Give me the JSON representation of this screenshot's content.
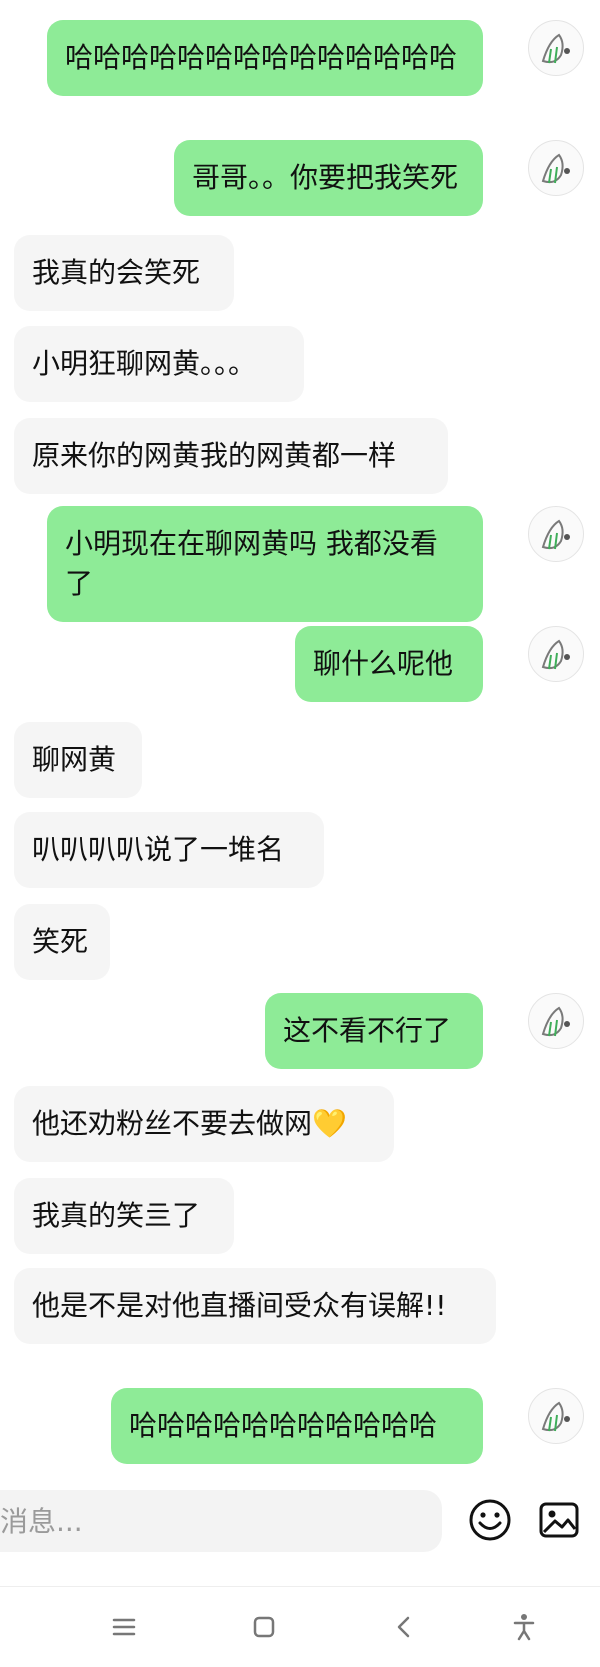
{
  "messages": [
    {
      "sender": "me",
      "text": "哈哈哈哈哈哈哈哈哈哈哈哈哈哈"
    },
    {
      "sender": "me",
      "text": "哥哥。。你要把我笑死"
    },
    {
      "sender": "them",
      "text": "我真的会笑死"
    },
    {
      "sender": "them",
      "text": "小明狂聊网黄。。。"
    },
    {
      "sender": "them",
      "text": "原来你的网黄我的网黄都一样"
    },
    {
      "sender": "me",
      "text": "小明现在在聊网黄吗 我都没看了"
    },
    {
      "sender": "me",
      "text": "聊什么呢他"
    },
    {
      "sender": "them",
      "text": "聊网黄"
    },
    {
      "sender": "them",
      "text": "叭叭叭叭说了一堆名"
    },
    {
      "sender": "them",
      "text": "笑死"
    },
    {
      "sender": "me",
      "text": "这不看不行了"
    },
    {
      "sender": "them",
      "text": "他还劝粉丝不要去做网💛"
    },
    {
      "sender": "them",
      "text": "我真的笑亖了"
    },
    {
      "sender": "them",
      "text": "他是不是对他直播间受众有误解!!"
    },
    {
      "sender": "me",
      "text": "哈哈哈哈哈哈哈哈哈哈哈"
    }
  ],
  "input": {
    "placeholder": "消息..."
  },
  "icons": {
    "emoji": "emoji-icon",
    "image": "image-icon",
    "avatar": "avatar-icon",
    "nav_menu": "menu-icon",
    "nav_home": "home-icon",
    "nav_back": "back-icon",
    "nav_accessibility": "accessibility-icon"
  },
  "colors": {
    "my_bubble": "#8eeb97",
    "their_bubble": "#f5f5f5",
    "text": "#111111",
    "placeholder": "#9a9a9a"
  }
}
